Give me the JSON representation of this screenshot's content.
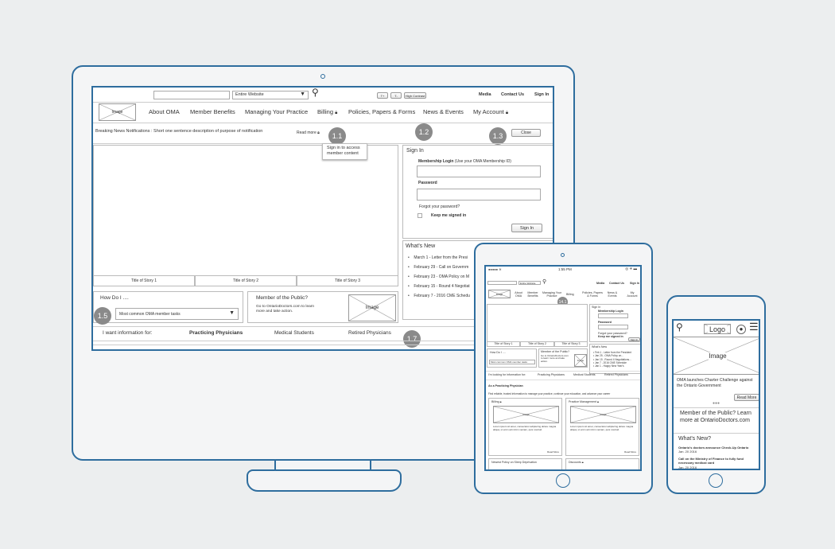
{
  "desktop": {
    "search_scope": "Entire Website",
    "text_size_up": "T+",
    "text_size_down": "T-",
    "high_contrast": "High Contrast",
    "utility_links": [
      "Media",
      "Contact Us",
      "Sign In"
    ],
    "logo_placeholder": "Image",
    "nav": [
      "About OMA",
      "Member Benefits",
      "Managing Your Practice",
      "Billing",
      "Policies, Papers & Forms",
      "News & Events",
      "My Account"
    ],
    "breaking_news": "Breaking News Notifications : Short one sentence description of purpose of notification",
    "read_more": "Read more",
    "tooltip": "Sign in to access member content",
    "close": "Close",
    "badges": [
      "1.1",
      "1.2",
      "1.3",
      "1.5",
      "1.7"
    ],
    "stories": [
      "Title of Story 1",
      "Title of Story 2",
      "Title of Story 3"
    ],
    "signin": {
      "title": "Sign In",
      "login_label": "Membership Login",
      "login_hint": "(Use your OMA Membership ID)",
      "password_label": "Password",
      "forgot": "Forgot your password?",
      "keep": "Keep me signed in",
      "button": "Sign In"
    },
    "whats_new": {
      "title": "What's New",
      "items": [
        "March 1 - Letter from the Presi",
        "February 29 - Call on Governm",
        "February 23 - OMA Policy on M",
        "February 15 - Round 4 Negotiat",
        "February 7 - 2016 CME Schedu"
      ]
    },
    "how_do_i": {
      "title": "How Do I ....",
      "select": "Most common OMA member tasks"
    },
    "public": {
      "title": "Member of the Public?",
      "text1": "Go to OntarioDoctors.com to learn",
      "text2": "more and take action.",
      "image": "Image"
    },
    "audience": {
      "label": "I want information for:",
      "options": [
        "Practicing Physicians",
        "Medical Students",
        "Retired Physicians"
      ]
    }
  },
  "tablet": {
    "time": "1:55 PM",
    "search_scope": "Entire Website",
    "utility_links": [
      "Media",
      "Contact Us",
      "Sign In"
    ],
    "logo_placeholder": "Image",
    "nav": [
      "About OMA",
      "Member Benefits",
      "Managing Your Practice",
      "Billing",
      "Policies, Papers & Forms",
      "News & Events",
      "My Account"
    ],
    "badge": "14.1",
    "stories": [
      "Title of Story 1",
      "Title of Story 2",
      "Title of Story 3"
    ],
    "signin": {
      "title": "Sign In",
      "login_label": "Membership Login",
      "password_label": "Password",
      "forgot": "Forgot your password?",
      "keep": "Keep me signed in",
      "button": "Sign In"
    },
    "whats_new": {
      "title": "What's New",
      "items": [
        "Feb 1 - Letter from the President",
        "Jan 25 - OMA Policy on...",
        "Jan 15 - Round 4 Negotiations...",
        "Jan 7 - 2016 CME Schedule",
        "Jan 1 - Happy New Year's"
      ]
    },
    "how_do_i": {
      "title": "How Do I ....",
      "select": "Most common OMA member tasks"
    },
    "public": {
      "title": "Member of the Public?",
      "text": "Go to OntarioDoctors.com to learn more and take action.",
      "image": "Image"
    },
    "audience": {
      "label": "I'm looking for information for:",
      "options": [
        "Practicing Physicians",
        "Medical Students",
        "Retired Physicians"
      ]
    },
    "section_title": "As a Practicing Physician",
    "section_desc": "Find reliable, trusted information to manage your practice, continue your education, and advance your career",
    "cards": [
      {
        "title": "Billing",
        "image": "Image",
        "text": "Lorem ipsum sit amet, consectetur adipiscing dolore magna aliqua, ut enim ad minim veniam, quis nostrud.",
        "more": "Read More"
      },
      {
        "title": "Practice Management",
        "image": "Image",
        "text": "Lorem ipsum sit amet, consectetur adipiscing dolore magna aliqua, ut enim ad minim veniam, quis nostrud.",
        "more": "Read More"
      },
      {
        "title": "Newest Policy on Sleep Deprivation"
      },
      {
        "title": "Discounts"
      }
    ]
  },
  "phone": {
    "logo": "Logo",
    "image": "Image",
    "headline": "OMA launches Charter Challenge against the Ontario Government",
    "read_more": "Read More",
    "public_text": "Member of the Public? Learn more at OntarioDoctors.com",
    "whats_new_title": "What's New?",
    "news": [
      {
        "title": "Ontario's doctors announce Check-Up Ontario",
        "date": "Jan. 20 2016"
      },
      {
        "title": "Call on the Ministry of Finance to fully fund necessary medical card",
        "date": "Jan. 20 2016"
      }
    ]
  },
  "colors": {
    "device_frame": "#2e6d9e",
    "badge": "#8a8a8a",
    "background": "#eceeef"
  }
}
